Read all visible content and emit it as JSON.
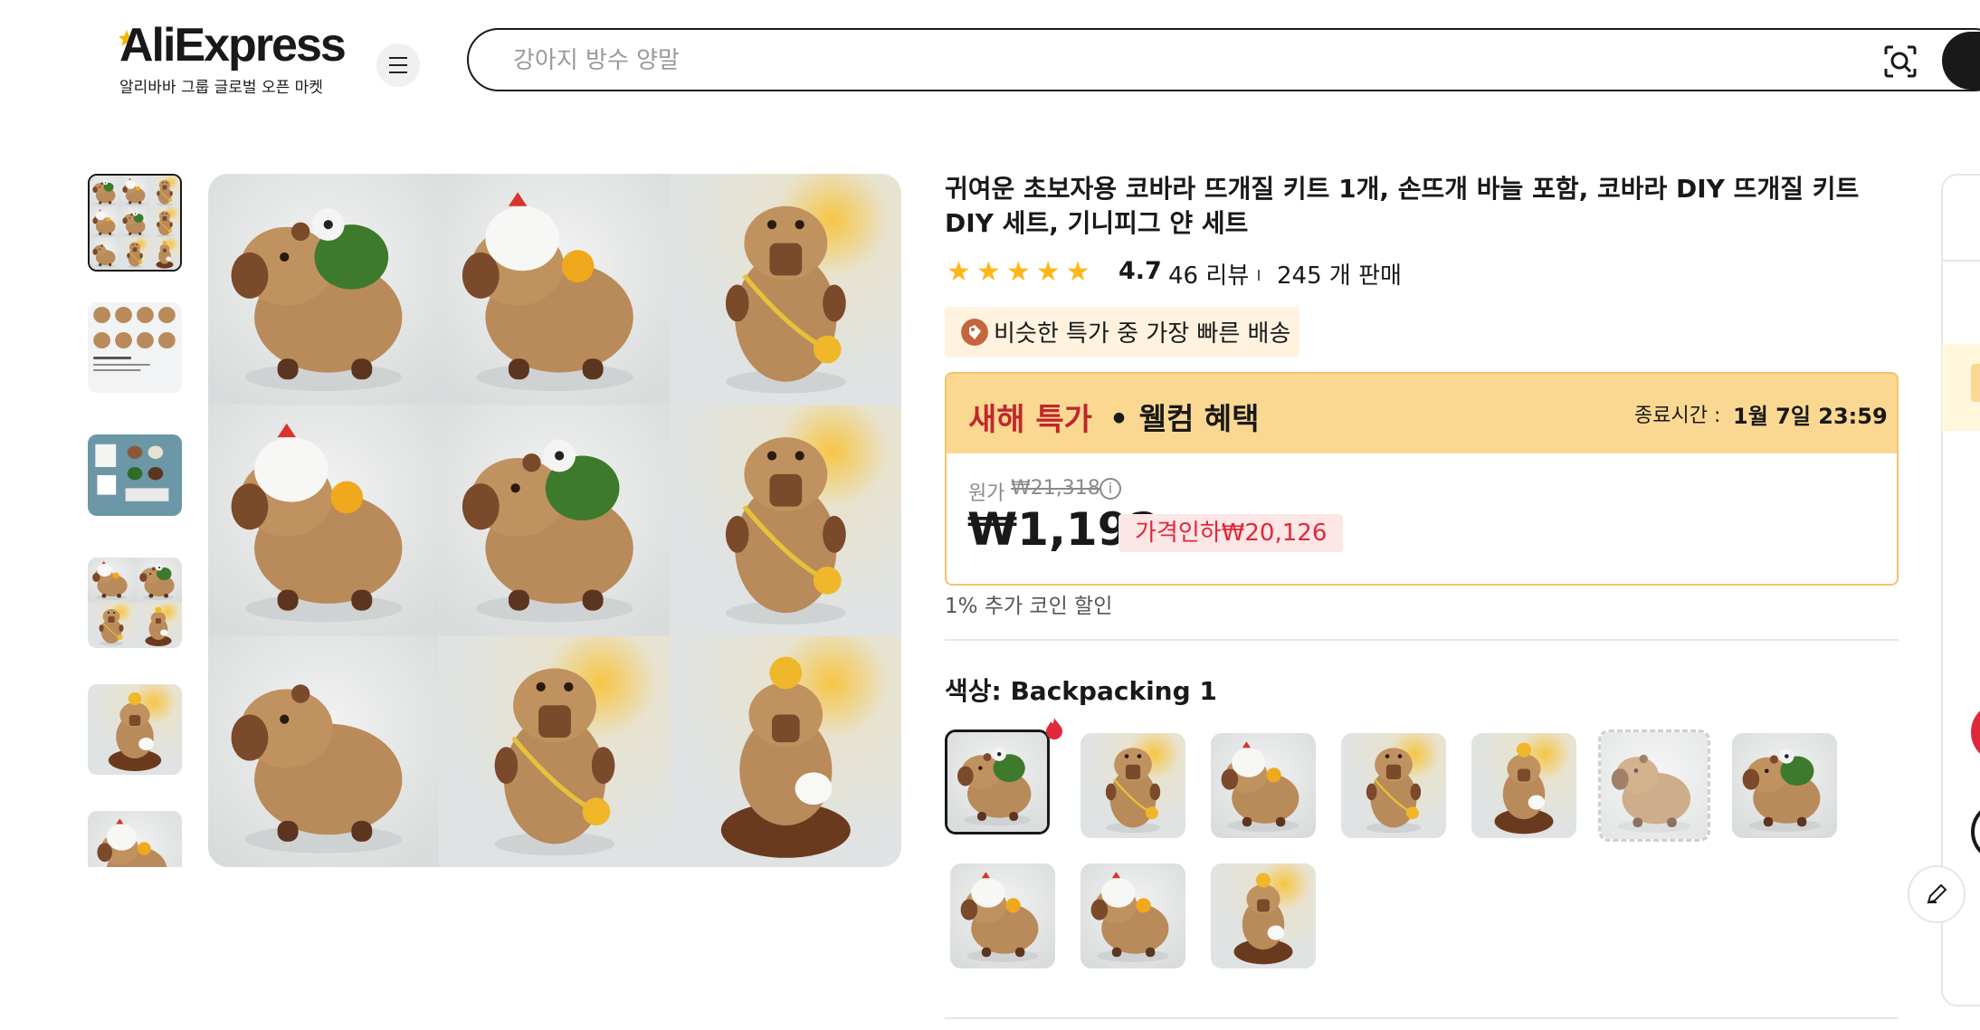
{
  "header": {
    "logo_text": "AliExpress",
    "logo_subtitle": "알리바바 그룹 글로벌 오픈 마켓",
    "search_placeholder": "강아지 방수 양말"
  },
  "product": {
    "title": "귀여운 초보자용 코바라 뜨개질 키트 1개, 손뜨개 바늘 포함, 코바라 DIY 뜨개질 키트 DIY 세트, 기니피그 얀 세트",
    "star_count": 5,
    "rating": "4.7",
    "reviews": "46 리뷰",
    "sold": "245 개 판매",
    "fast_shipping": "비슷한 특가 중 가장 빠른 배송"
  },
  "deal": {
    "title": "새해 특가",
    "subtitle": "• 웰컴 혜택",
    "ends_label": "종료시간 :",
    "ends_value": "1월 7일 23:59",
    "original_label": "원가",
    "original_price": "₩21,318",
    "price": "₩1,192",
    "price_drop": "가격인하₩20,126",
    "coin_discount": "1% 추가 코인 할인"
  },
  "variants": {
    "color_label": "색상: Backpacking 1",
    "selected_index": 0
  },
  "colors": {
    "accent_red": "#e0283a",
    "deal_header": "#fad892",
    "star": "#fdb71b"
  }
}
